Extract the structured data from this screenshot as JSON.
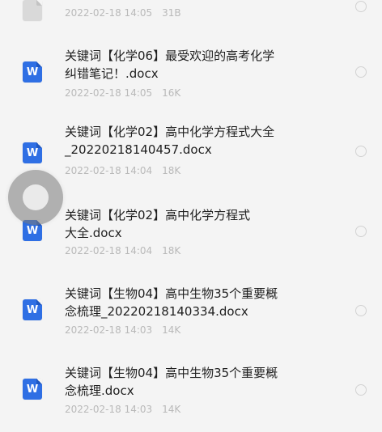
{
  "files": [
    {
      "name": "",
      "date": "2022-02-18 14:05",
      "size": "31B",
      "icon": "generic-file-icon"
    },
    {
      "name": "关键词【化学06】最受欢迎的高考化学\n纠错笔记！.docx",
      "date": "2022-02-18 14:05",
      "size": "16K",
      "icon": "word-doc-icon"
    },
    {
      "name": "关键词【化学02】高中化学方程式大全\n_20220218140457.docx",
      "date": "2022-02-18 14:04",
      "size": "18K",
      "icon": "word-doc-icon"
    },
    {
      "name": "关键词【化学02】高中化学方程式\n大全.docx",
      "date": "2022-02-18 14:04",
      "size": "18K",
      "icon": "word-doc-icon"
    },
    {
      "name": "关键词【生物04】高中生物35个重要概\n念梳理_20220218140334.docx",
      "date": "2022-02-18 14:03",
      "size": "14K",
      "icon": "word-doc-icon"
    },
    {
      "name": "关键词【生物04】高中生物35个重要概\n念梳理.docx",
      "date": "2022-02-18 14:03",
      "size": "14K",
      "icon": "word-doc-icon"
    }
  ],
  "word_icon_letter": "W",
  "colors": {
    "background": "#f4f4f4",
    "word_icon": "#2f6fe4",
    "title_text": "#1f1f1f",
    "meta_text": "#b9b9b9",
    "select_circle": "#d2d2d2"
  }
}
